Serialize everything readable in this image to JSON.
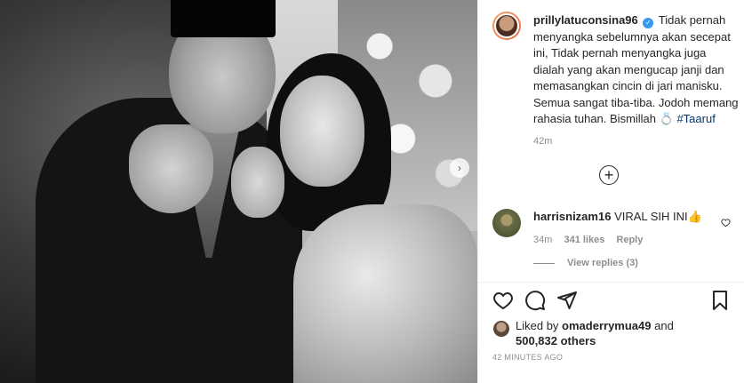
{
  "caption": {
    "username": "prillylatuconsina96",
    "text": "Tidak pernah menyangka sebelumnya akan secepat ini, Tidak pernah menyangka juga dialah yang akan mengucap janji dan memasangkan cincin di jari manisku. Semua sangat tiba-tiba. Jodoh memang rahasia tuhan. Bismillah 💍",
    "hashtag": "#Taaruf",
    "time": "42m"
  },
  "comment": {
    "username": "harrisnizam16",
    "text": "VIRAL SIH INI👍",
    "time": "34m",
    "likes": "341 likes",
    "reply": "Reply",
    "view_replies": "View replies (3)"
  },
  "likes": {
    "prefix": "Liked by",
    "user": "omaderrymua49",
    "and": "and",
    "others": "500,832 others"
  },
  "posted": "42 MINUTES AGO",
  "icons": {
    "like": "heart-icon",
    "comment": "comment-icon",
    "share": "share-icon",
    "save": "bookmark-icon",
    "load_more": "plus-circle-icon",
    "verified": "verified-badge-icon",
    "next": "chevron-right-icon"
  },
  "colors": {
    "verified": "#3897f0",
    "hashtag": "#00376b",
    "muted": "#8e8e8e",
    "text": "#262626"
  }
}
